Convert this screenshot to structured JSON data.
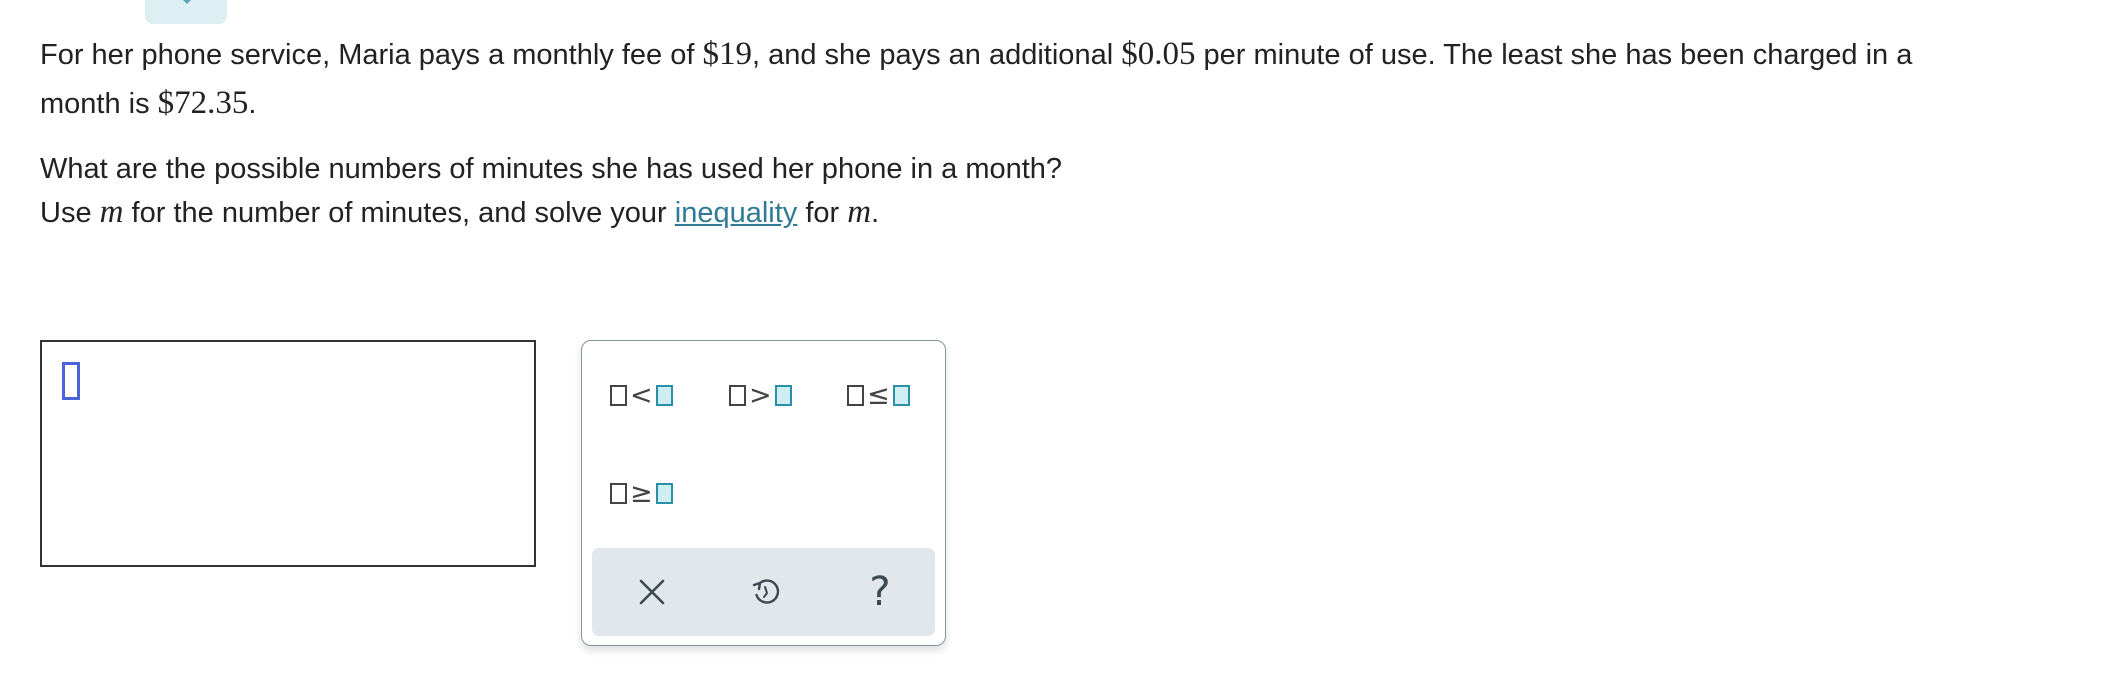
{
  "problem": {
    "line1_a": "For her phone service, Maria pays a monthly fee of ",
    "fee": "$19",
    "line1_b": ", and she pays an additional ",
    "rate": "$0.05",
    "line1_c": " per minute of use. The least she has been charged in a",
    "line2_a": "month is ",
    "least": "$72.35",
    "line2_b": "."
  },
  "question": {
    "line1": "What are the possible numbers of minutes she has used her phone in a month?",
    "line2_a": "Use ",
    "var": "m",
    "line2_b": " for the number of minutes, and solve your ",
    "link": "inequality",
    "line2_c": " for ",
    "var2": "m",
    "line2_d": "."
  },
  "palette": {
    "ops": {
      "lt": "<",
      "gt": ">",
      "le": "≤",
      "ge": "≥"
    },
    "actions": {
      "clear": "x-icon",
      "undo": "undo-icon",
      "help": "?"
    },
    "colors": {
      "accent": "#2c8fa8",
      "accent_fill": "#cfeef4",
      "bar": "#e1e7ea",
      "link": "#2f7a94"
    }
  }
}
